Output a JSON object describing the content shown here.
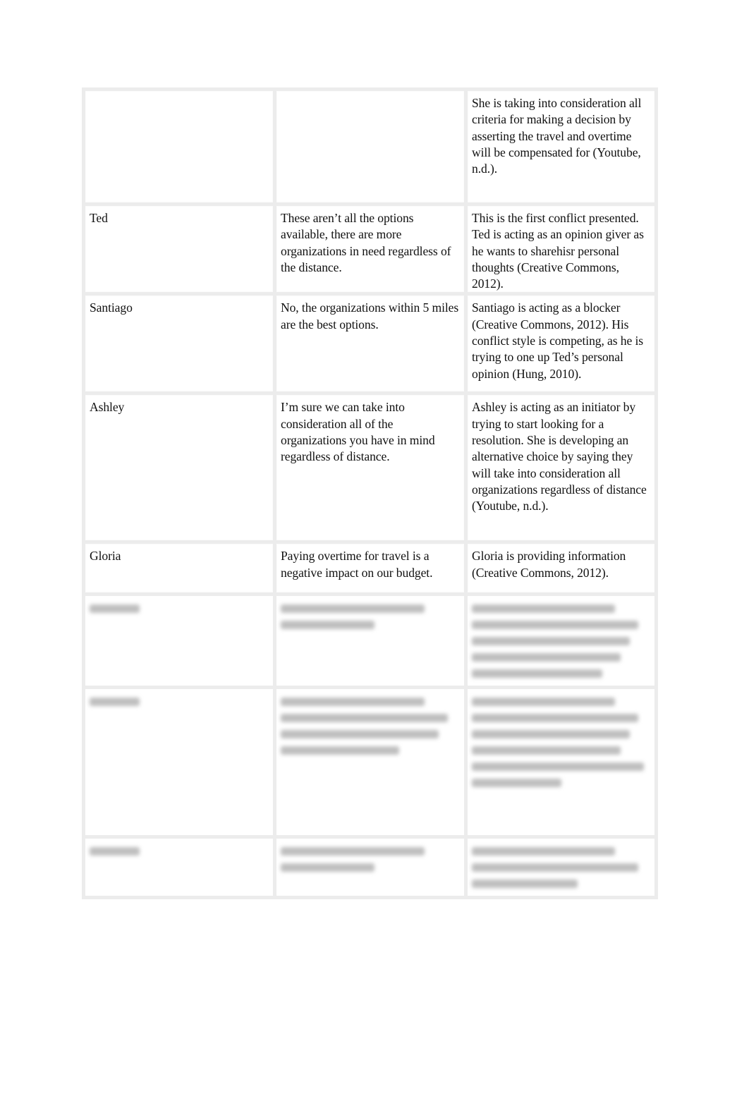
{
  "document": {
    "table": {
      "rows": [
        {
          "member": "",
          "statement": "",
          "analysis": "She is taking into consideration all criteria for making a decision by asserting the travel and overtime will be compensated for (Youtube, n.d.)."
        },
        {
          "member": "Ted",
          "statement": "These aren’t all the options available, there are more organizations in need regardless of the distance.",
          "analysis": "This is the first conflict presented. Ted is acting as an opinion giver as he wants to sharehisr personal thoughts (Creative Commons, 2012)."
        },
        {
          "member": "Santiago",
          "statement": "No, the organizations within 5 miles are the best options.",
          "analysis": "Santiago is acting as a blocker (Creative Commons, 2012).  His conflict style is competing, as he is trying to one up Ted’s personal opinion (Hung, 2010)."
        },
        {
          "member": "Ashley",
          "statement": "I’m sure we can take into consideration all of the organizations you have in mind regardless of distance.",
          "analysis": "Ashley is acting as an initiator by trying to start looking for a resolution.  She is developing an alternative choice by saying they will take into consideration all organizations regardless of distance (Youtube, n.d.)."
        },
        {
          "member": "Gloria",
          "statement": "Paying overtime for travel is a negative impact on our budget.",
          "analysis": "Gloria is providing information (Creative Commons, 2012)."
        }
      ],
      "blurred_rows": [
        {
          "member_lines": 1,
          "statement_lines": 2,
          "analysis_lines": 5
        },
        {
          "member_lines": 1,
          "statement_lines": 4,
          "analysis_lines": 6
        },
        {
          "member_lines": 1,
          "statement_lines": 2,
          "analysis_lines": 3
        }
      ]
    }
  }
}
